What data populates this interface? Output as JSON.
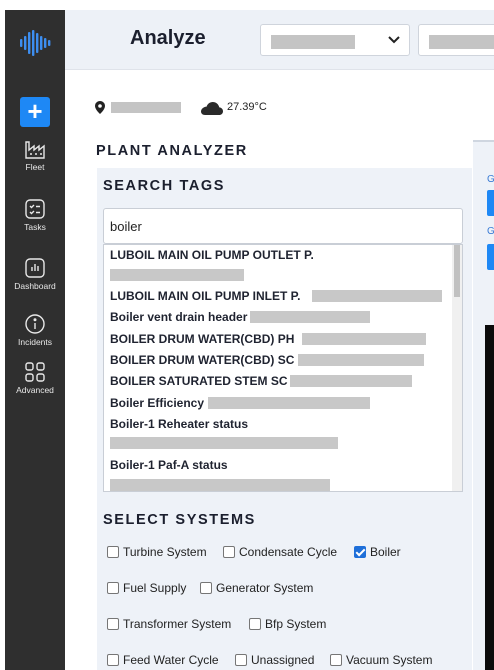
{
  "sidebar": {
    "add_label": "+",
    "items": [
      {
        "label": "Fleet",
        "icon": "factory-icon"
      },
      {
        "label": "Tasks",
        "icon": "tasks-icon"
      },
      {
        "label": "Dashboard",
        "icon": "dashboard-icon"
      },
      {
        "label": "Incidents",
        "icon": "info-icon"
      },
      {
        "label": "Advanced",
        "icon": "grid-icon"
      }
    ]
  },
  "header": {
    "title": "Analyze"
  },
  "weather": {
    "temperature": "27.39°C",
    "icon": "cloud-icon"
  },
  "plant_analyzer": {
    "heading": "PLANT ANALYZER",
    "search": {
      "heading": "SEARCH TAGS",
      "value": "boiler",
      "results": [
        "LUBOIL MAIN OIL PUMP OUTLET P.",
        "LUBOIL MAIN OIL PUMP INLET P.",
        "Boiler vent drain header",
        "BOILER DRUM WATER(CBD) PH",
        "BOILER DRUM WATER(CBD) SC",
        "BOILER SATURATED STEM SC",
        "Boiler Efficiency",
        "Boiler-1 Reheater status",
        "Boiler-1 Paf-A status"
      ]
    },
    "systems": {
      "heading": "SELECT SYSTEMS",
      "items": [
        {
          "label": "Turbine System",
          "checked": false
        },
        {
          "label": "Condensate Cycle",
          "checked": false
        },
        {
          "label": "Boiler",
          "checked": true
        },
        {
          "label": "Fuel Supply",
          "checked": false
        },
        {
          "label": "Generator System",
          "checked": false
        },
        {
          "label": "Transformer System",
          "checked": false
        },
        {
          "label": "Bfp System",
          "checked": false
        },
        {
          "label": "Feed Water Cycle",
          "checked": false
        },
        {
          "label": "Unassigned",
          "checked": false
        },
        {
          "label": "Vacuum System",
          "checked": false
        }
      ]
    }
  },
  "right_panel": {
    "label_1": "G",
    "label_2": "G"
  },
  "colors": {
    "sidebar_bg": "#2f2f2f",
    "accent": "#1e88f5",
    "panel_bg": "#eef2f8",
    "topbar_bg": "#edf1f7"
  }
}
